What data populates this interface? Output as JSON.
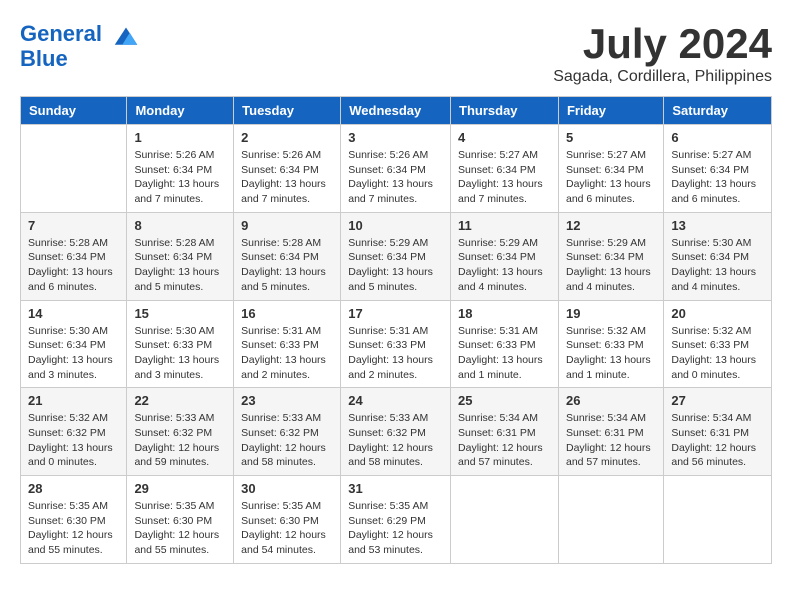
{
  "header": {
    "logo_line1": "General",
    "logo_line2": "Blue",
    "month": "July 2024",
    "location": "Sagada, Cordillera, Philippines"
  },
  "weekdays": [
    "Sunday",
    "Monday",
    "Tuesday",
    "Wednesday",
    "Thursday",
    "Friday",
    "Saturday"
  ],
  "weeks": [
    [
      {
        "day": "",
        "info": ""
      },
      {
        "day": "1",
        "info": "Sunrise: 5:26 AM\nSunset: 6:34 PM\nDaylight: 13 hours\nand 7 minutes."
      },
      {
        "day": "2",
        "info": "Sunrise: 5:26 AM\nSunset: 6:34 PM\nDaylight: 13 hours\nand 7 minutes."
      },
      {
        "day": "3",
        "info": "Sunrise: 5:26 AM\nSunset: 6:34 PM\nDaylight: 13 hours\nand 7 minutes."
      },
      {
        "day": "4",
        "info": "Sunrise: 5:27 AM\nSunset: 6:34 PM\nDaylight: 13 hours\nand 7 minutes."
      },
      {
        "day": "5",
        "info": "Sunrise: 5:27 AM\nSunset: 6:34 PM\nDaylight: 13 hours\nand 6 minutes."
      },
      {
        "day": "6",
        "info": "Sunrise: 5:27 AM\nSunset: 6:34 PM\nDaylight: 13 hours\nand 6 minutes."
      }
    ],
    [
      {
        "day": "7",
        "info": "Sunrise: 5:28 AM\nSunset: 6:34 PM\nDaylight: 13 hours\nand 6 minutes."
      },
      {
        "day": "8",
        "info": "Sunrise: 5:28 AM\nSunset: 6:34 PM\nDaylight: 13 hours\nand 5 minutes."
      },
      {
        "day": "9",
        "info": "Sunrise: 5:28 AM\nSunset: 6:34 PM\nDaylight: 13 hours\nand 5 minutes."
      },
      {
        "day": "10",
        "info": "Sunrise: 5:29 AM\nSunset: 6:34 PM\nDaylight: 13 hours\nand 5 minutes."
      },
      {
        "day": "11",
        "info": "Sunrise: 5:29 AM\nSunset: 6:34 PM\nDaylight: 13 hours\nand 4 minutes."
      },
      {
        "day": "12",
        "info": "Sunrise: 5:29 AM\nSunset: 6:34 PM\nDaylight: 13 hours\nand 4 minutes."
      },
      {
        "day": "13",
        "info": "Sunrise: 5:30 AM\nSunset: 6:34 PM\nDaylight: 13 hours\nand 4 minutes."
      }
    ],
    [
      {
        "day": "14",
        "info": "Sunrise: 5:30 AM\nSunset: 6:34 PM\nDaylight: 13 hours\nand 3 minutes."
      },
      {
        "day": "15",
        "info": "Sunrise: 5:30 AM\nSunset: 6:33 PM\nDaylight: 13 hours\nand 3 minutes."
      },
      {
        "day": "16",
        "info": "Sunrise: 5:31 AM\nSunset: 6:33 PM\nDaylight: 13 hours\nand 2 minutes."
      },
      {
        "day": "17",
        "info": "Sunrise: 5:31 AM\nSunset: 6:33 PM\nDaylight: 13 hours\nand 2 minutes."
      },
      {
        "day": "18",
        "info": "Sunrise: 5:31 AM\nSunset: 6:33 PM\nDaylight: 13 hours\nand 1 minute."
      },
      {
        "day": "19",
        "info": "Sunrise: 5:32 AM\nSunset: 6:33 PM\nDaylight: 13 hours\nand 1 minute."
      },
      {
        "day": "20",
        "info": "Sunrise: 5:32 AM\nSunset: 6:33 PM\nDaylight: 13 hours\nand 0 minutes."
      }
    ],
    [
      {
        "day": "21",
        "info": "Sunrise: 5:32 AM\nSunset: 6:32 PM\nDaylight: 13 hours\nand 0 minutes."
      },
      {
        "day": "22",
        "info": "Sunrise: 5:33 AM\nSunset: 6:32 PM\nDaylight: 12 hours\nand 59 minutes."
      },
      {
        "day": "23",
        "info": "Sunrise: 5:33 AM\nSunset: 6:32 PM\nDaylight: 12 hours\nand 58 minutes."
      },
      {
        "day": "24",
        "info": "Sunrise: 5:33 AM\nSunset: 6:32 PM\nDaylight: 12 hours\nand 58 minutes."
      },
      {
        "day": "25",
        "info": "Sunrise: 5:34 AM\nSunset: 6:31 PM\nDaylight: 12 hours\nand 57 minutes."
      },
      {
        "day": "26",
        "info": "Sunrise: 5:34 AM\nSunset: 6:31 PM\nDaylight: 12 hours\nand 57 minutes."
      },
      {
        "day": "27",
        "info": "Sunrise: 5:34 AM\nSunset: 6:31 PM\nDaylight: 12 hours\nand 56 minutes."
      }
    ],
    [
      {
        "day": "28",
        "info": "Sunrise: 5:35 AM\nSunset: 6:30 PM\nDaylight: 12 hours\nand 55 minutes."
      },
      {
        "day": "29",
        "info": "Sunrise: 5:35 AM\nSunset: 6:30 PM\nDaylight: 12 hours\nand 55 minutes."
      },
      {
        "day": "30",
        "info": "Sunrise: 5:35 AM\nSunset: 6:30 PM\nDaylight: 12 hours\nand 54 minutes."
      },
      {
        "day": "31",
        "info": "Sunrise: 5:35 AM\nSunset: 6:29 PM\nDaylight: 12 hours\nand 53 minutes."
      },
      {
        "day": "",
        "info": ""
      },
      {
        "day": "",
        "info": ""
      },
      {
        "day": "",
        "info": ""
      }
    ]
  ]
}
